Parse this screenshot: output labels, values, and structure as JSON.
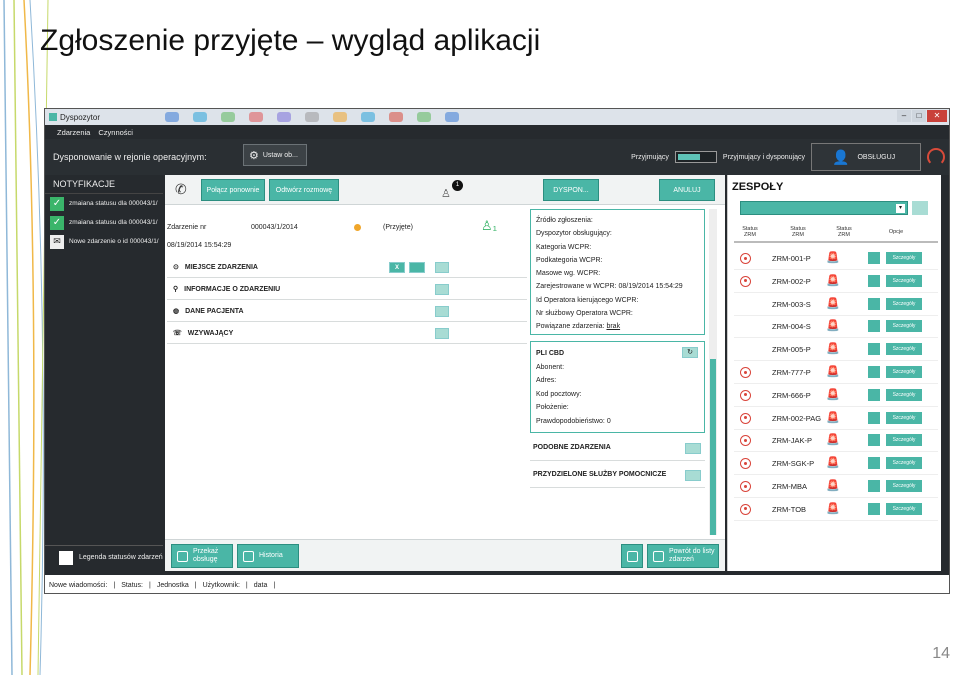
{
  "slide": {
    "title": "Zgłoszenie przyjęte – wygląd aplikacji",
    "page_number": "14"
  },
  "window": {
    "title": "Dyspozytor"
  },
  "menu": [
    "Zdarzenia",
    "Czynności"
  ],
  "header": {
    "region_label": "Dysponowanie w rejonie operacyjnym:",
    "set_button": "Ustaw ob...",
    "mode_left": "Przyjmujący",
    "mode_right": "Przyjmujący i dysponujący",
    "serve_button": "OBSŁUGUJ"
  },
  "notifications": {
    "title": "NOTYFIKACJE",
    "items": [
      {
        "text": "zmaiana statusu dla 000043/1/",
        "icon": "check-icon"
      },
      {
        "text": "zmaiana statusu dla 000043/1/",
        "icon": "check-icon"
      },
      {
        "text": "Nowe zdarzenie o id 000043/1/",
        "icon": "envelope-icon"
      }
    ],
    "legend": "Legenda statusów zdarzeń"
  },
  "toolbar": {
    "reconnect": "Połącz ponownie",
    "open_call": "Odtwórz rozmowę",
    "badge": "1",
    "dispatch": "DYSPON...",
    "cancel": "ANULUJ"
  },
  "incident": {
    "number_label": "Zdarzenie nr",
    "number": "000043/1/2014",
    "datetime": "08/19/2014 15:54:29",
    "status": "(Przyjęte)",
    "sections": [
      "MIEJSCE ZDARZENIA",
      "INFORMACJE O ZDARZENIU",
      "DANE PACJENTA",
      "WZYWAJĄCY"
    ],
    "place_x": "X"
  },
  "details": {
    "lines": [
      "Źródło zgłoszenia:",
      "Dyspozytor obsługujący:",
      "Kategoria WCPR:",
      "Podkategoria WCPR:",
      "Masowe wg. WCPR:",
      "Zarejestrowane w WCPR:  08/19/2014 15:54:29",
      "Id Operatora kierującego WCPR:",
      "Nr służbowy Operatora WCPR:"
    ],
    "related_label": "Powiązane zdarzenia:",
    "related_link": "brak"
  },
  "pli": {
    "title": "PLI CBD",
    "lines": [
      "Abonent:",
      "Adres:",
      "Kod pocztowy:",
      "Położenie:",
      "Prawdopodobieństwo:  0"
    ]
  },
  "similar": "PODOBNE ZDARZENIA",
  "assigned": "PRZYDZIELONE SŁUŻBY POMOCNICZE",
  "bottom": {
    "handover": "Przekaż obsługę",
    "history": "Historia",
    "back": "Powrót do listy zdarzeń"
  },
  "teams": {
    "title": "ZESPOŁY",
    "headers": [
      "Status ZRM",
      "Status ZRM",
      "Status ZRM",
      "Opcje"
    ],
    "detail_label": "Szczegóły",
    "rows": [
      {
        "code": "ZRM-001-P",
        "alarm": true
      },
      {
        "code": "ZRM-002-P",
        "alarm": true
      },
      {
        "code": "ZRM-003-S",
        "alarm": false
      },
      {
        "code": "ZRM-004-S",
        "alarm": false
      },
      {
        "code": "ZRM-005-P",
        "alarm": false
      },
      {
        "code": "ZRM-777-P",
        "alarm": true
      },
      {
        "code": "ZRM-666-P",
        "alarm": true
      },
      {
        "code": "ZRM-002-PAG",
        "alarm": true
      },
      {
        "code": "ZRM-JAK-P",
        "alarm": true
      },
      {
        "code": "ZRM-SGK-P",
        "alarm": true
      },
      {
        "code": "ZRM-MBA",
        "alarm": true
      },
      {
        "code": "ZRM-TOB",
        "alarm": true
      }
    ]
  },
  "statusbar": [
    "Nowe wiadomości:",
    "Status:",
    "Jednostka",
    "Użytkownik:",
    "data"
  ]
}
